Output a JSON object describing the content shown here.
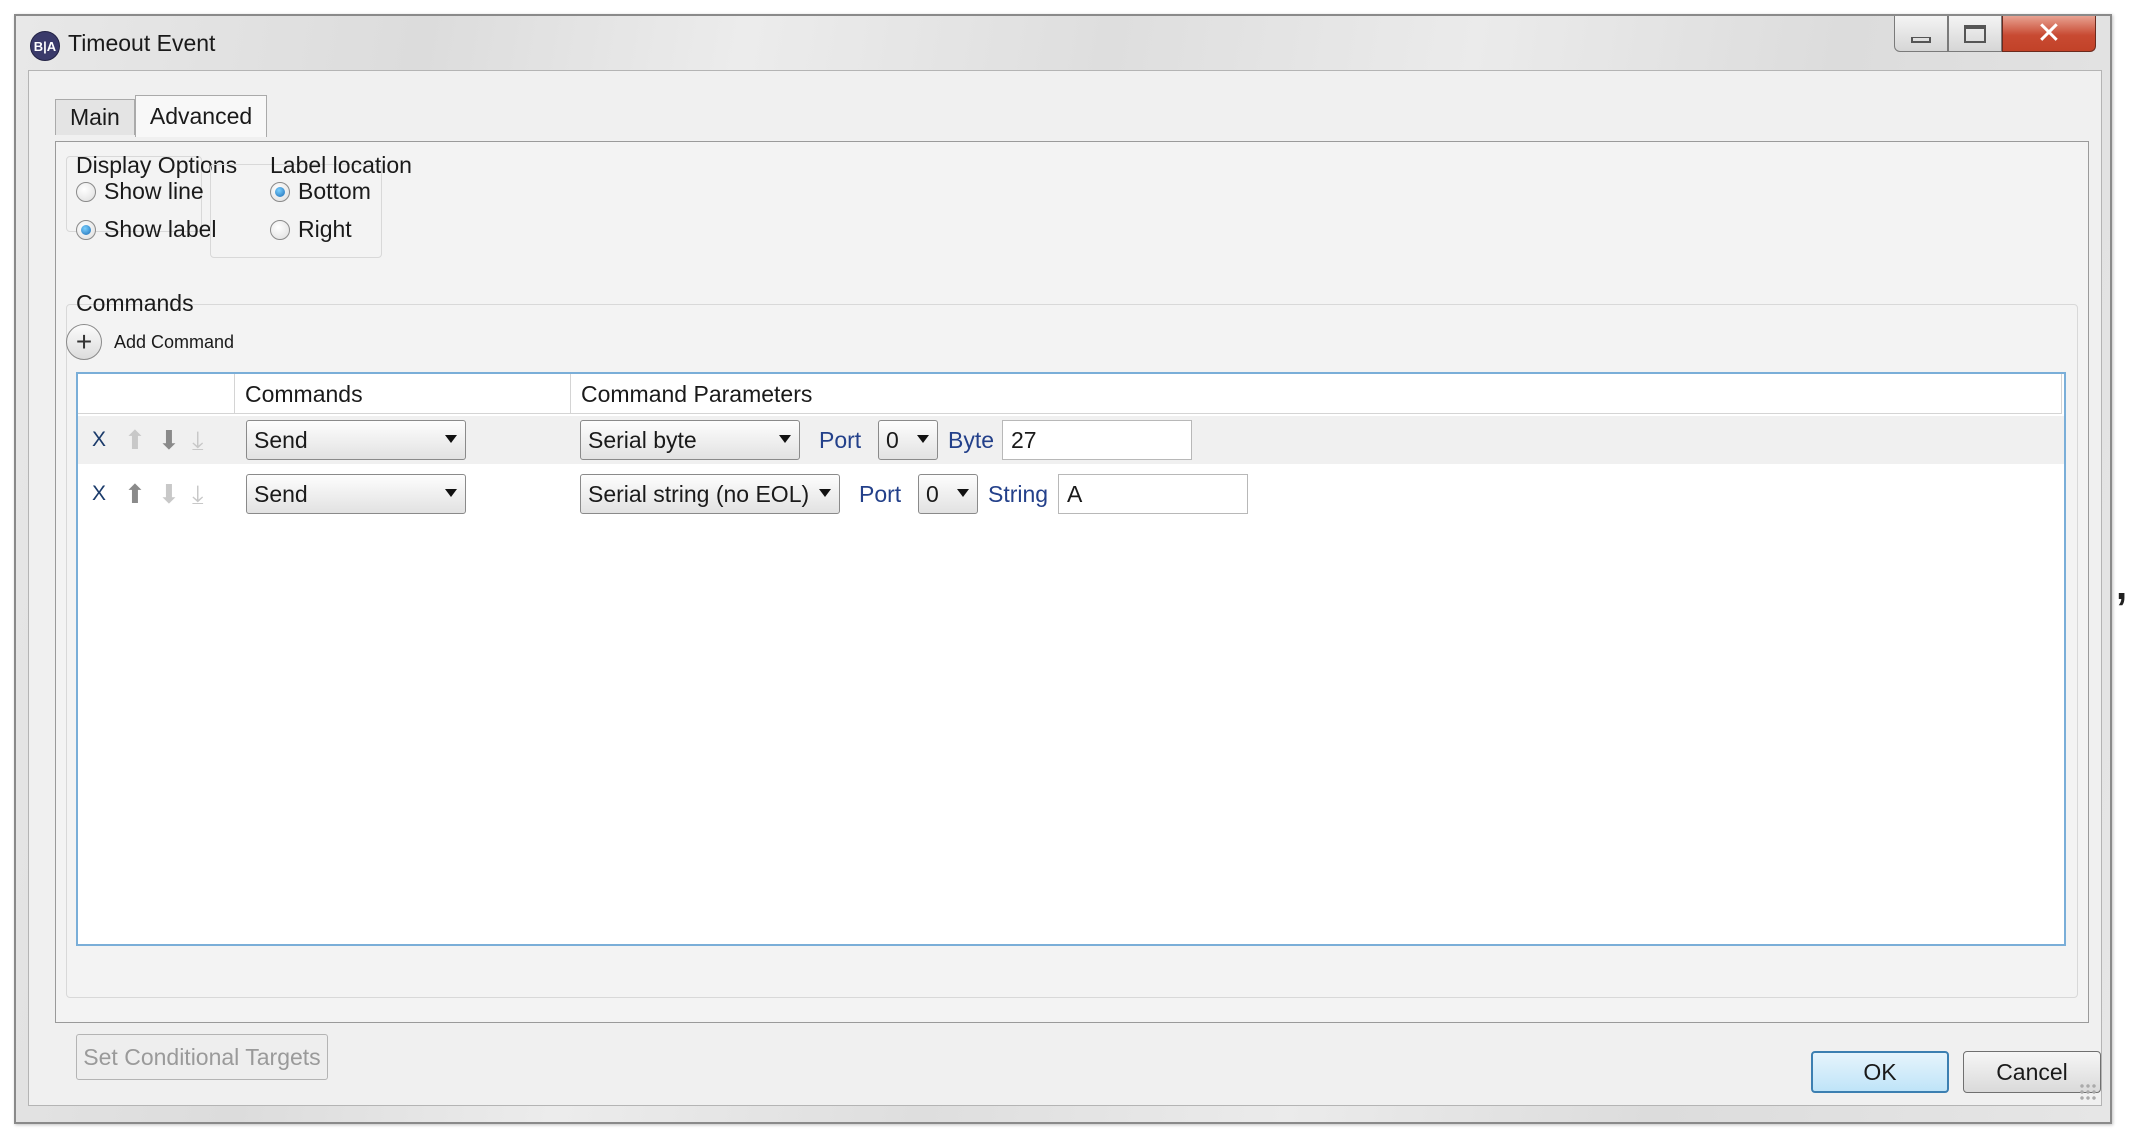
{
  "window": {
    "title": "Timeout Event",
    "app_icon_text": "B|A",
    "minimize_icon": "minimize-icon",
    "maximize_icon": "maximize-icon",
    "close_glyph": "✕"
  },
  "tabs": [
    {
      "label": "Main",
      "active": false
    },
    {
      "label": "Advanced",
      "active": true
    }
  ],
  "display_options": {
    "title": "Display Options",
    "options": [
      {
        "label": "Show line",
        "checked": false
      },
      {
        "label": "Show label",
        "checked": true
      }
    ]
  },
  "label_location": {
    "title": "Label location",
    "options": [
      {
        "label": "Bottom",
        "checked": true
      },
      {
        "label": "Right",
        "checked": false
      }
    ]
  },
  "commands": {
    "title": "Commands",
    "add_label": "Add Command",
    "columns": [
      "Commands",
      "Command Parameters"
    ],
    "rows": [
      {
        "delete": "X",
        "command": "Send",
        "param_type": "Serial byte",
        "port_label": "Port",
        "port_value": "0",
        "value_label": "Byte",
        "value": "27"
      },
      {
        "delete": "X",
        "command": "Send",
        "param_type": "Serial string (no EOL)",
        "port_label": "Port",
        "port_value": "0",
        "value_label": "String",
        "value": "A"
      }
    ]
  },
  "buttons": {
    "conditional": "Set Conditional Targets",
    "ok": "OK",
    "cancel": "Cancel"
  },
  "stray_mark": ","
}
